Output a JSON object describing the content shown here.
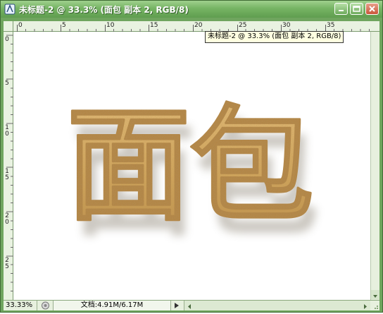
{
  "window": {
    "title": "未标题-2 @ 33.3% (面包 副本 2, RGB/8)",
    "tooltip": "未标题-2 @ 33.3% (面包 副本 2, RGB/8)",
    "controls": [
      "minimize-icon",
      "restore-icon",
      "close-icon"
    ]
  },
  "rulers": {
    "horizontal_labels": [
      "0",
      "5",
      "10",
      "15",
      "20",
      "25",
      "30",
      "35"
    ],
    "vertical_labels": [
      "0",
      "5",
      "10",
      "15",
      "20",
      "25"
    ]
  },
  "canvas": {
    "text": "面包",
    "fill_color": "#d6a85a",
    "shadow_color": "#b7b1a4"
  },
  "status": {
    "zoom": "33.33%",
    "doc_info": "文档:4.91M/6.17M"
  },
  "colors": {
    "frame": "#6fa55e",
    "title_text": "#ffffff",
    "tooltip_bg": "#ffffe1"
  }
}
